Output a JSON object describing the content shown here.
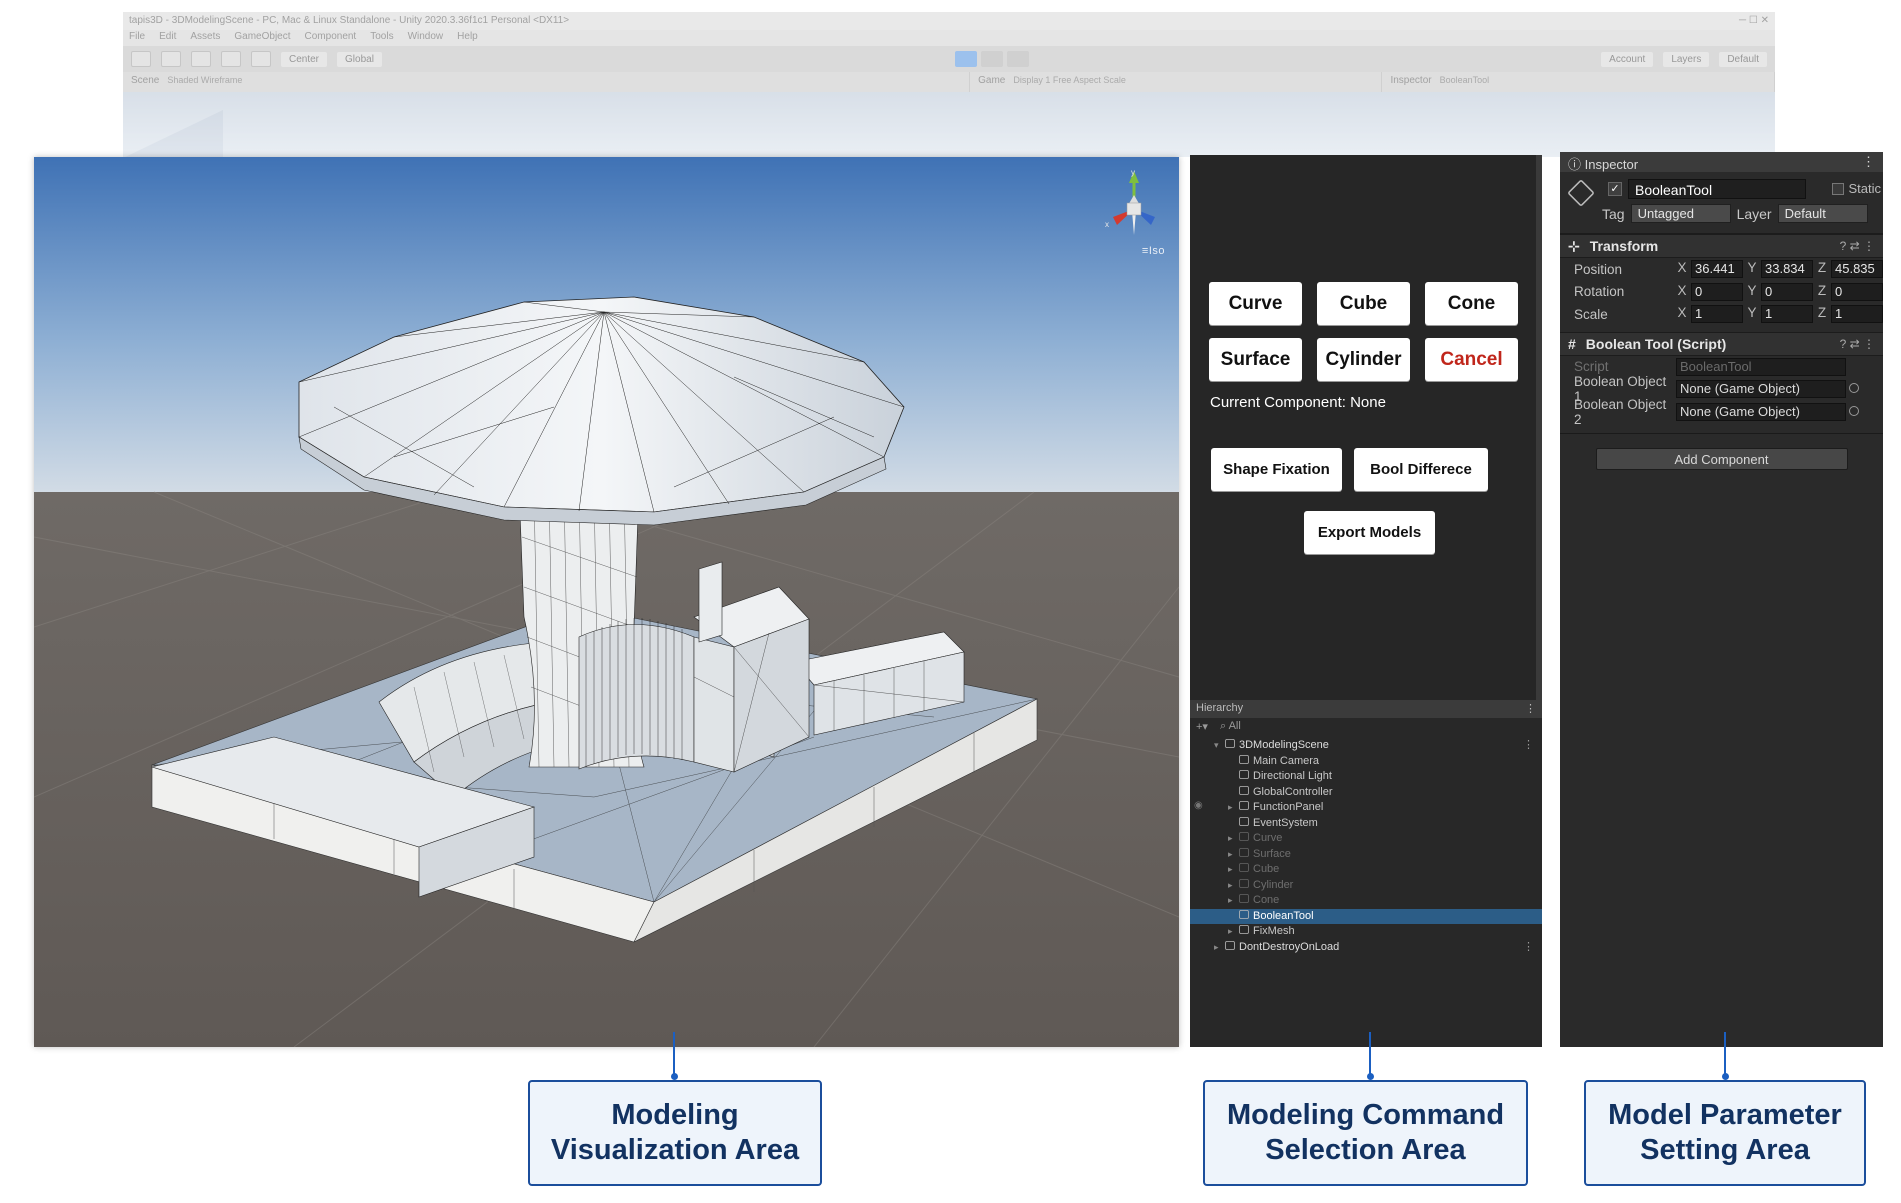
{
  "background_editor": {
    "title": "tapis3D - 3DModelingScene - PC, Mac & Linux Standalone - Unity 2020.3.36f1c1 Personal <DX11>",
    "menu": [
      "File",
      "Edit",
      "Assets",
      "GameObject",
      "Component",
      "Tools",
      "Window",
      "Help"
    ],
    "toolbar": {
      "center": "Center",
      "global": "Global",
      "account": "Account",
      "layers": "Layers",
      "layout": "Default"
    },
    "tabs": {
      "scene": "Scene",
      "scene_hint": "Shaded Wireframe",
      "game": "Game",
      "game_hint": "Display 1   Free Aspect   Scale",
      "inspector": "Inspector",
      "inspector_hint": "BooleanTool"
    }
  },
  "viewport": {
    "iso_label": "≡Iso",
    "gizmo": {
      "y": "y",
      "x": "x"
    }
  },
  "command_panel": {
    "buttons": {
      "curve": "Curve",
      "cube": "Cube",
      "cone": "Cone",
      "surface": "Surface",
      "cylinder": "Cylinder",
      "cancel": "Cancel",
      "shape_fixation": "Shape Fixation",
      "bool_difference": "Bool Differece",
      "export_models": "Export Models"
    },
    "status": "Current Component: None",
    "cancel_color": "#c0261b"
  },
  "hierarchy": {
    "title": "Hierarchy",
    "search_placeholder": "All",
    "items": [
      {
        "label": "3DModelingScene",
        "kind": "scene"
      },
      {
        "label": "Main Camera",
        "kind": "normal"
      },
      {
        "label": "Directional Light",
        "kind": "normal"
      },
      {
        "label": "GlobalController",
        "kind": "normal"
      },
      {
        "label": "FunctionPanel",
        "kind": "normal"
      },
      {
        "label": "EventSystem",
        "kind": "normal"
      },
      {
        "label": "Curve",
        "kind": "dim"
      },
      {
        "label": "Surface",
        "kind": "dim"
      },
      {
        "label": "Cube",
        "kind": "dim"
      },
      {
        "label": "Cylinder",
        "kind": "dim"
      },
      {
        "label": "Cone",
        "kind": "dim"
      },
      {
        "label": "BooleanTool",
        "kind": "selected"
      },
      {
        "label": "FixMesh",
        "kind": "normal"
      },
      {
        "label": "DontDestroyOnLoad",
        "kind": "scene"
      }
    ],
    "selected_color": "#2c5d87"
  },
  "inspector": {
    "title": "Inspector",
    "object_name": "BooleanTool",
    "static_label": "Static",
    "tag_label": "Tag",
    "tag_value": "Untagged",
    "layer_label": "Layer",
    "layer_value": "Default",
    "transform": {
      "title": "Transform",
      "position_label": "Position",
      "rotation_label": "Rotation",
      "scale_label": "Scale",
      "position": {
        "x": "36.441",
        "y": "33.834",
        "z": "45.835"
      },
      "rotation": {
        "x": "0",
        "y": "0",
        "z": "0"
      },
      "scale": {
        "x": "1",
        "y": "1",
        "z": "1"
      }
    },
    "script_component": {
      "title": "Boolean Tool (Script)",
      "script_label": "Script",
      "script_value": "BooleanTool",
      "obj1_label": "Boolean Object 1",
      "obj1_value": "None (Game Object)",
      "obj2_label": "Boolean Object 2",
      "obj2_value": "None (Game Object)"
    },
    "add_component": "Add Component"
  },
  "callouts": {
    "viz": {
      "line1": "Modeling",
      "line2": "Visualization Area"
    },
    "cmd": {
      "line1": "Modeling Command",
      "line2": "Selection Area"
    },
    "param": {
      "line1": "Model Parameter",
      "line2": "Setting Area"
    },
    "accent": "#1b5fc1"
  }
}
